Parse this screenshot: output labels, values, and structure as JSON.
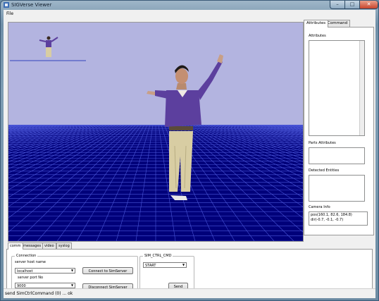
{
  "window": {
    "title": "SIGVerse Viewer",
    "buttons": {
      "minimize": "–",
      "maximize": "□",
      "close": "✕"
    }
  },
  "menu": {
    "file": "File"
  },
  "right_panel": {
    "tabs": [
      {
        "label": "Attributes"
      },
      {
        "label": "Command"
      }
    ],
    "attributes_label": "Attributes",
    "parts_attributes_label": "Parts Attributes",
    "detected_entities_label": "Detected Entities",
    "camera_info_label": "Camera Info",
    "camera_info_text": "pos(160.1, 82.6, 184.8)\ndir(-0.7, -0.1, -0.7)"
  },
  "bottom_panel": {
    "tabs": [
      {
        "label": "comm"
      },
      {
        "label": "messages"
      },
      {
        "label": "video"
      },
      {
        "label": "syslog"
      }
    ],
    "connection": {
      "group_title": "Connection",
      "host_label": "server host name",
      "host_value": "localhost",
      "port_label": "server port No",
      "port_value": "9000",
      "connect_button": "Connect to SimServer",
      "disconnect_button": "Disconnect SimServer"
    },
    "sim_ctrl": {
      "group_title": "SIM_CTRL_CMD",
      "cmd_value": "START",
      "send_button": "Send"
    }
  },
  "status": {
    "text": "send SimCtrlCommand (0) ... ok"
  },
  "colors": {
    "sky": "#b3b4e0",
    "floor": "#00007a",
    "grid": "#4a56d8",
    "shirt": "#5c3f9e",
    "pants": "#d8cda3"
  }
}
